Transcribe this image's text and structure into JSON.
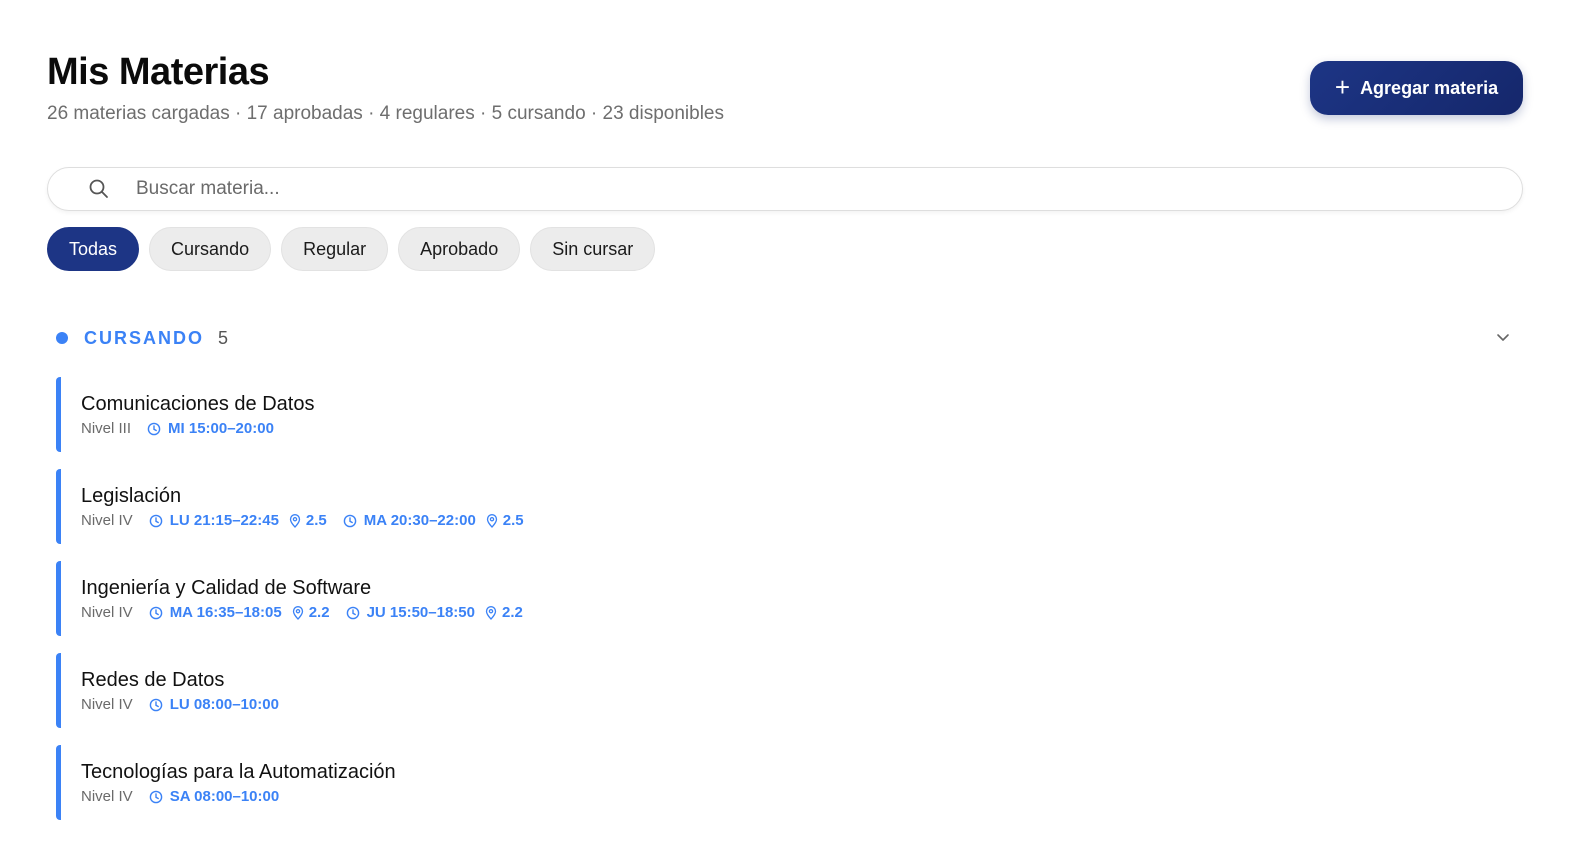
{
  "header": {
    "title": "Mis Materias",
    "subtitle": "26 materias cargadas · 17 aprobadas · 4 regulares · 5 cursando · 23 disponibles"
  },
  "add_button": {
    "icon": "plus-icon",
    "label": "Agregar materia",
    "color": "#1d3585"
  },
  "search": {
    "icon": "search-icon",
    "placeholder": "Buscar materia...",
    "value": ""
  },
  "filters": [
    {
      "label": "Todas",
      "active": true
    },
    {
      "label": "Cursando",
      "active": false
    },
    {
      "label": "Regular",
      "active": false
    },
    {
      "label": "Aprobado",
      "active": false
    },
    {
      "label": "Sin cursar",
      "active": false
    }
  ],
  "section": {
    "label": "CURSANDO",
    "count": "5",
    "color": "#3b82f6",
    "collapse_icon": "chevron-down-icon"
  },
  "subjects": [
    {
      "name": "Comunicaciones de Datos",
      "level": "Nivel III",
      "schedules": [
        {
          "time": "MI 15:00–20:00",
          "room": ""
        }
      ]
    },
    {
      "name": "Legislación",
      "level": "Nivel IV",
      "schedules": [
        {
          "time": "LU 21:15–22:45",
          "room": "2.5"
        },
        {
          "time": "MA 20:30–22:00",
          "room": "2.5"
        }
      ]
    },
    {
      "name": "Ingeniería y Calidad de Software",
      "level": "Nivel IV",
      "schedules": [
        {
          "time": "MA 16:35–18:05",
          "room": "2.2"
        },
        {
          "time": "JU 15:50–18:50",
          "room": "2.2"
        }
      ]
    },
    {
      "name": "Redes de Datos",
      "level": "Nivel IV",
      "schedules": [
        {
          "time": "LU 08:00–10:00",
          "room": ""
        }
      ]
    },
    {
      "name": "Tecnologías para la Automatización",
      "level": "Nivel IV",
      "schedules": [
        {
          "time": "SA 08:00–10:00",
          "room": ""
        }
      ]
    }
  ]
}
